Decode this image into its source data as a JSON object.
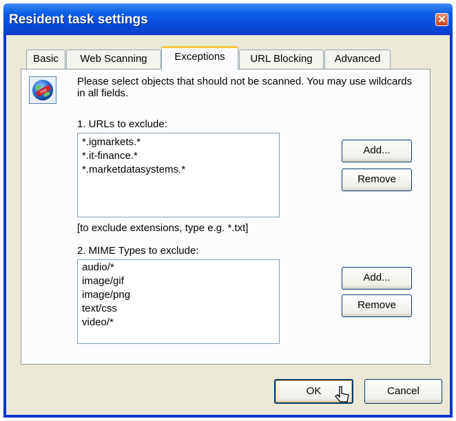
{
  "window": {
    "title": "Resident task settings",
    "close_glyph": "✕"
  },
  "tabs": [
    {
      "label": "Basic",
      "active": false
    },
    {
      "label": "Web Scanning",
      "active": false
    },
    {
      "label": "Exceptions",
      "active": true
    },
    {
      "label": "URL Blocking",
      "active": false
    },
    {
      "label": "Advanced",
      "active": false
    }
  ],
  "exceptions": {
    "info_icon": "globe-http-icon",
    "description": "Please select objects that should not be scanned. You may use wildcards in all fields.",
    "urls": {
      "label": "1. URLs to exclude:",
      "items": [
        "*.igmarkets.*",
        "*.it-finance.*",
        "*.marketdatasystems.*"
      ],
      "add_label": "Add...",
      "remove_label": "Remove",
      "hint": "[to exclude extensions, type e.g. *.txt]"
    },
    "mime": {
      "label": "2. MIME Types to exclude:",
      "items": [
        "audio/*",
        "image/gif",
        "image/png",
        "text/css",
        "video/*"
      ],
      "add_label": "Add...",
      "remove_label": "Remove"
    }
  },
  "footer": {
    "ok_label": "OK",
    "cancel_label": "Cancel"
  },
  "colors": {
    "titlebar": "#0b5fe6",
    "dialog_bg": "#ece9d8",
    "active_tab_accent": "#ffc83c"
  }
}
